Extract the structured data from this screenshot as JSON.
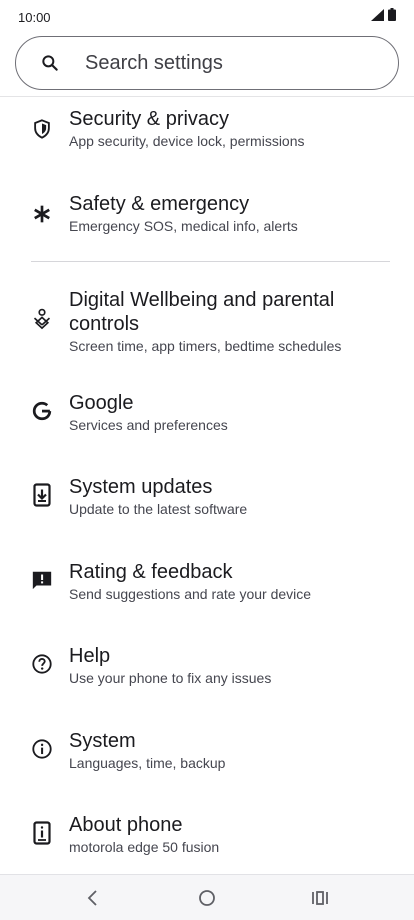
{
  "status_bar": {
    "time": "10:00",
    "signal_icon": "signal-icon",
    "battery_icon": "battery-icon"
  },
  "search": {
    "placeholder": "Search settings",
    "icon": "search-icon"
  },
  "items": [
    {
      "title": "Security & privacy",
      "subtitle": "App security, device lock, permissions",
      "icon": "shield-icon"
    },
    {
      "title": "Safety & emergency",
      "subtitle": "Emergency SOS, medical info, alerts",
      "icon": "asterisk-icon"
    },
    {
      "title": "Digital Wellbeing and parental controls",
      "subtitle": "Screen time, app timers, bedtime schedules",
      "icon": "wellbeing-icon"
    },
    {
      "title": "Google",
      "subtitle": "Services and preferences",
      "icon": "google-icon"
    },
    {
      "title": "System updates",
      "subtitle": "Update to the latest software",
      "icon": "system-update-icon"
    },
    {
      "title": "Rating & feedback",
      "subtitle": "Send suggestions and rate your device",
      "icon": "feedback-icon"
    },
    {
      "title": "Help",
      "subtitle": "Use your phone to fix any issues",
      "icon": "help-icon"
    },
    {
      "title": "System",
      "subtitle": "Languages, time, backup",
      "icon": "info-icon"
    },
    {
      "title": "About phone",
      "subtitle": "motorola edge 50 fusion",
      "icon": "phone-info-icon"
    }
  ],
  "nav": {
    "back": "back-icon",
    "home": "home-icon",
    "recents": "recents-icon"
  }
}
